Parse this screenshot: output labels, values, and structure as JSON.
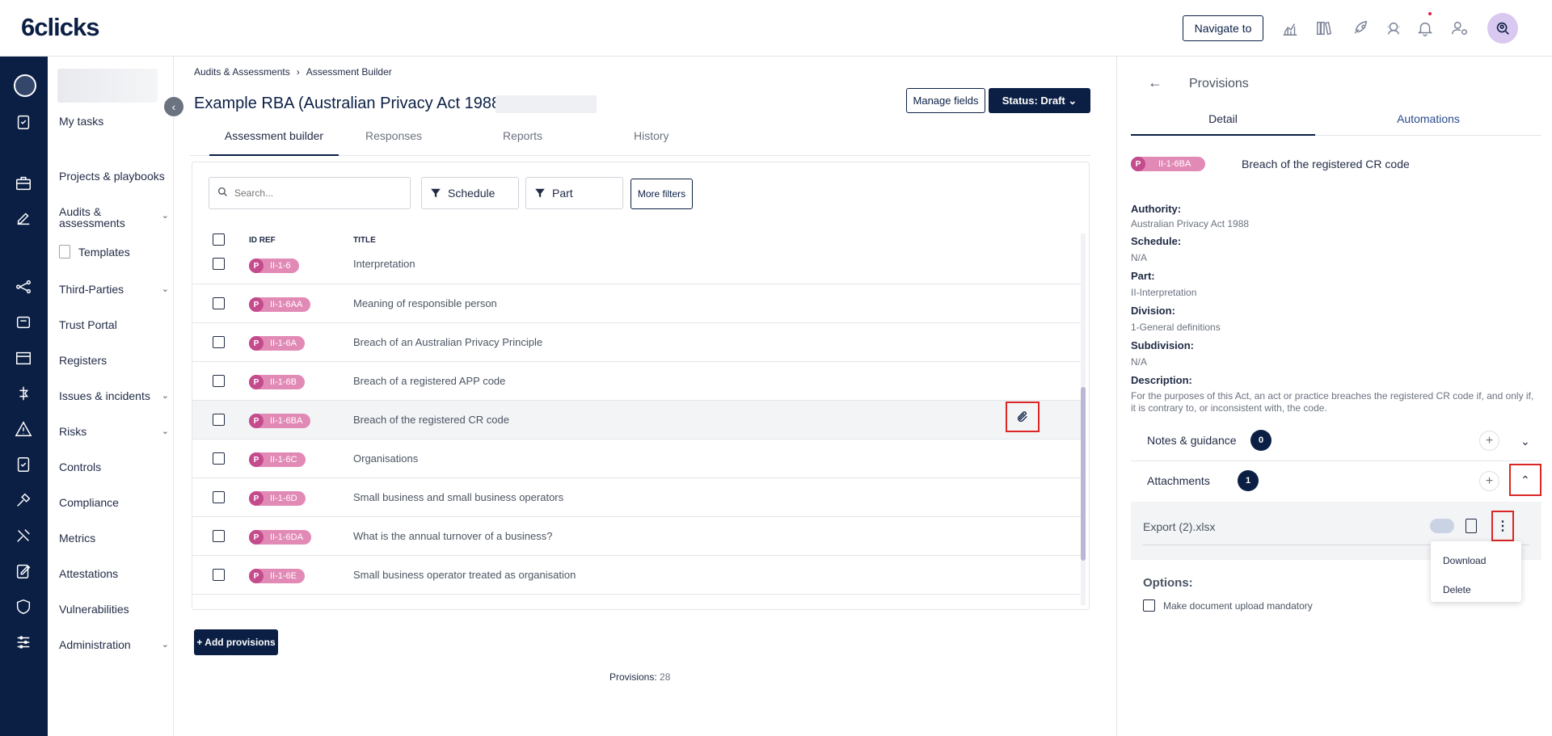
{
  "brand": {
    "logo_text": "6clicks"
  },
  "topbar": {
    "navigate_label": "Navigate to",
    "icons": [
      "analytics-icon",
      "library-icon",
      "rocket-icon",
      "support-icon",
      "bell-icon",
      "user-settings-icon",
      "search-user-icon"
    ]
  },
  "sidebar": {
    "my_tasks": "My tasks",
    "projects": "Projects & playbooks",
    "audits": "Audits & assessments",
    "templates": "Templates",
    "third_parties": "Third-Parties",
    "trust_portal": "Trust Portal",
    "registers": "Registers",
    "issues": "Issues & incidents",
    "risks": "Risks",
    "controls": "Controls",
    "compliance": "Compliance",
    "metrics": "Metrics",
    "attestations": "Attestations",
    "vulnerabilities": "Vulnerabilities",
    "administration": "Administration"
  },
  "breadcrumb": {
    "first": "Audits & Assessments",
    "separator": "›",
    "second": "Assessment Builder"
  },
  "page": {
    "title": "Example RBA (Australian Privacy Act 1988)",
    "manage_fields": "Manage fields",
    "status": "Status: Draft ⌄"
  },
  "tabs": [
    "Assessment builder",
    "Responses",
    "Reports",
    "History"
  ],
  "filters": {
    "search_placeholder": "Search...",
    "schedule": "Schedule",
    "part": "Part",
    "more_filters": "More filters"
  },
  "table": {
    "col_id": "ID REF",
    "col_title": "TITLE",
    "badge_letter": "P",
    "rows": [
      {
        "id": "II-1-6",
        "title": "Interpretation"
      },
      {
        "id": "II-1-6AA",
        "title": "Meaning of responsible person"
      },
      {
        "id": "II-1-6A",
        "title": "Breach of an Australian Privacy Principle"
      },
      {
        "id": "II-1-6B",
        "title": "Breach of a registered APP code"
      },
      {
        "id": "II-1-6BA",
        "title": "Breach of the registered CR code"
      },
      {
        "id": "II-1-6C",
        "title": "Organisations"
      },
      {
        "id": "II-1-6D",
        "title": "Small business and small business operators"
      },
      {
        "id": "II-1-6DA",
        "title": "What is the annual turnover of a business?"
      },
      {
        "id": "II-1-6E",
        "title": "Small business operator treated as organisation"
      }
    ]
  },
  "footer": {
    "add_provisions": "+ Add provisions",
    "provisions_label": "Provisions:",
    "provisions_count": "28"
  },
  "panel": {
    "title": "Provisions",
    "tab_detail": "Detail",
    "tab_automations": "Automations",
    "badge_letter": "P",
    "provision_id": "II-1-6BA",
    "provision_title": "Breach of the registered CR code",
    "authority_label": "Authority:",
    "authority_value": "Australian Privacy Act 1988",
    "schedule_label": "Schedule:",
    "schedule_value": "N/A",
    "part_label": "Part:",
    "part_value": "II-Interpretation",
    "division_label": "Division:",
    "division_value": "1-General definitions",
    "subdivision_label": "Subdivision:",
    "subdivision_value": "N/A",
    "description_label": "Description:",
    "description_value": "For the purposes of this Act, an act or practice breaches the registered CR code if, and only if, it is contrary to, or inconsistent with, the code.",
    "notes_label": "Notes & guidance",
    "notes_count": "0",
    "attachments_label": "Attachments",
    "attachments_count": "1",
    "attachment_file": "Export (2).xlsx",
    "menu_download": "Download",
    "menu_delete": "Delete",
    "options_label": "Options:",
    "option_mandatory": "Make document upload mandatory"
  }
}
